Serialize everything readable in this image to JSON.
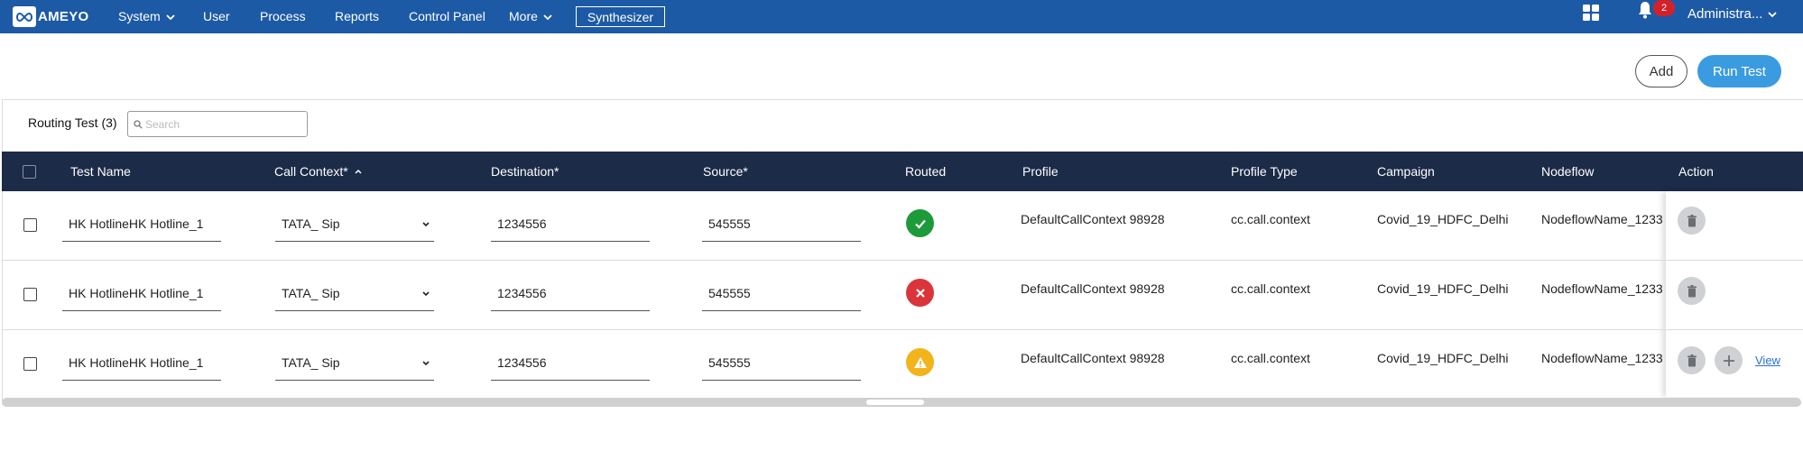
{
  "brand": {
    "logo_text": "AMEYO"
  },
  "nav": {
    "items": [
      {
        "label": "System",
        "has_dropdown": true
      },
      {
        "label": "User",
        "has_dropdown": false
      },
      {
        "label": "Process",
        "has_dropdown": false
      },
      {
        "label": "Reports",
        "has_dropdown": false
      },
      {
        "label": "Control Panel",
        "has_dropdown": false
      },
      {
        "label": "More",
        "has_dropdown": true
      }
    ],
    "synth_button": "Synthesizer",
    "notification_count": "2",
    "user_label": "Administra..."
  },
  "toolbar": {
    "add_label": "Add",
    "run_label": "Run Test"
  },
  "table": {
    "title": "Routing Test (3)",
    "search_placeholder": "Search",
    "columns": [
      "Test Name",
      "Call Context*",
      "Destination*",
      "Source*",
      "Routed",
      "Profile",
      "Profile Type",
      "Campaign",
      "Nodeflow",
      "Action"
    ],
    "rows": [
      {
        "test_name": "HK HotlineHK Hotline_1",
        "call_context": "TATA_ Sip",
        "destination": "1234556",
        "source": "545555",
        "routed": "success",
        "profile": "DefaultCallContext 98928",
        "profile_type": "cc.call.context",
        "campaign": "Covid_19_HDFC_Delhi",
        "nodeflow": "NodeflowName_1233",
        "actions": [
          "delete"
        ]
      },
      {
        "test_name": "HK HotlineHK Hotline_1",
        "call_context": "TATA_ Sip",
        "destination": "1234556",
        "source": "545555",
        "routed": "failed",
        "profile": "DefaultCallContext 98928",
        "profile_type": "cc.call.context",
        "campaign": "Covid_19_HDFC_Delhi",
        "nodeflow": "NodeflowName_1233",
        "actions": [
          "delete"
        ]
      },
      {
        "test_name": "HK HotlineHK Hotline_1",
        "call_context": "TATA_ Sip",
        "destination": "1234556",
        "source": "545555",
        "routed": "warning",
        "profile": "DefaultCallContext 98928",
        "profile_type": "cc.call.context",
        "campaign": "Covid_19_HDFC_Delhi",
        "nodeflow": "NodeflowName_1233",
        "actions": [
          "delete",
          "add",
          "view"
        ],
        "view_label": "View"
      }
    ]
  },
  "colors": {
    "nav_bg": "#1d5aa6",
    "table_header_bg": "#1b2b48",
    "primary_button": "#3b9be0",
    "success": "#1e9a3b",
    "error": "#d9353a",
    "warning": "#f2b41b",
    "badge": "#d42028"
  }
}
